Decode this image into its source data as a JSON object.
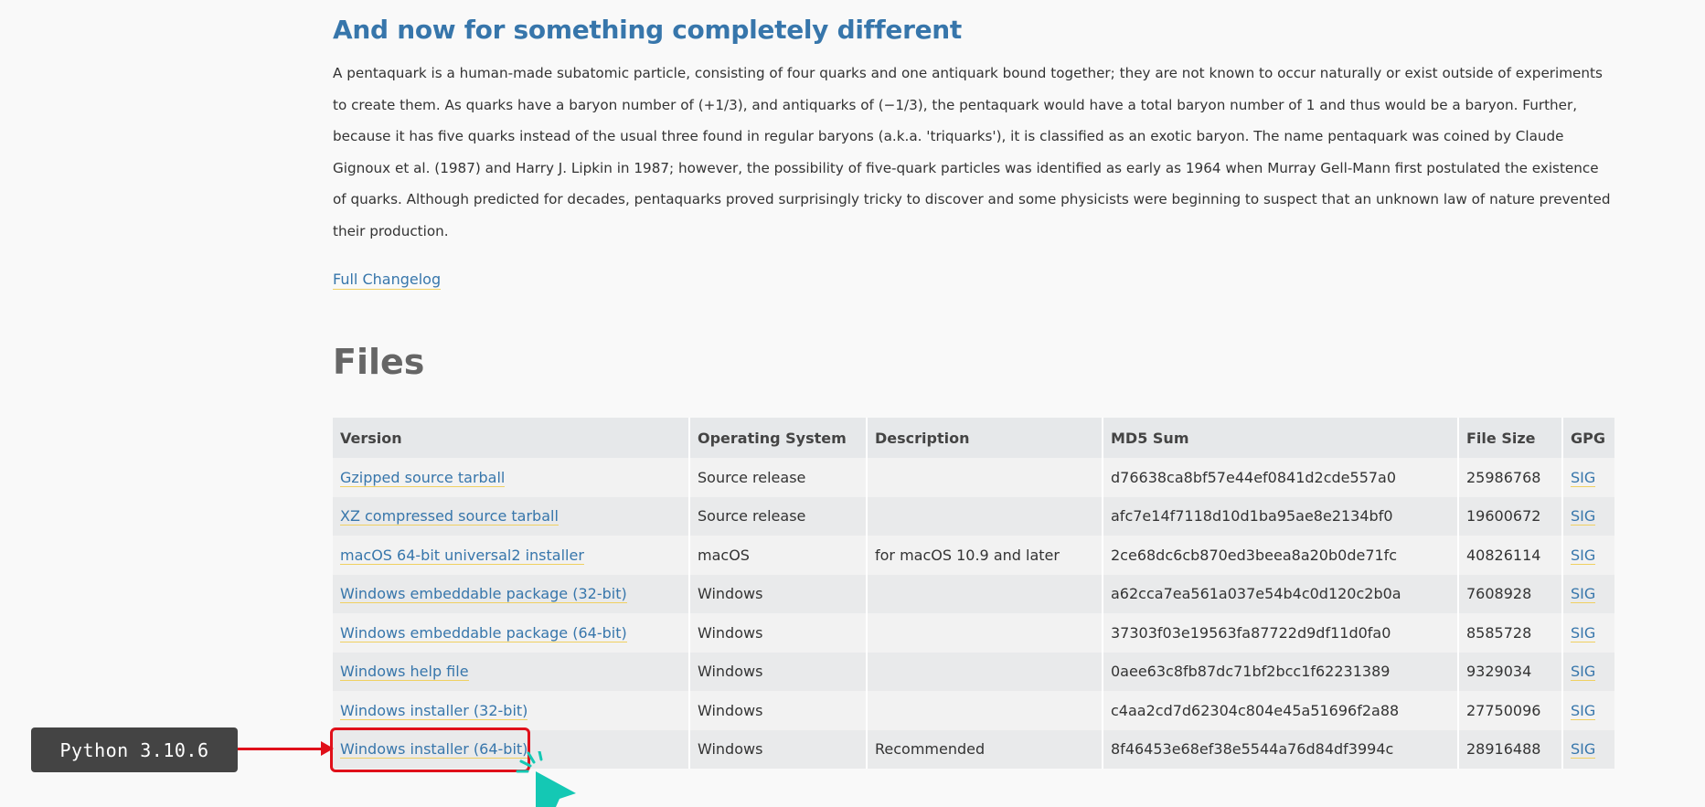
{
  "article": {
    "heading": "And now for something completely different",
    "paragraph": "A pentaquark is a human-made subatomic particle, consisting of four quarks and one antiquark bound together; they are not known to occur naturally or exist outside of experiments to create them. As quarks have a baryon number of (+1/3), and antiquarks of (−1/3), the pentaquark would have a total baryon number of 1 and thus would be a baryon. Further, because it has five quarks instead of the usual three found in regular baryons (a.k.a. 'triquarks'), it is classified as an exotic baryon. The name pentaquark was coined by Claude Gignoux et al. (1987) and Harry J. Lipkin in 1987; however, the possibility of five-quark particles was identified as early as 1964 when Murray Gell-Mann first postulated the existence of quarks. Although predicted for decades, pentaquarks proved surprisingly tricky to discover and some physicists were beginning to suspect that an unknown law of nature prevented their production.",
    "changelog_link": "Full Changelog"
  },
  "files": {
    "heading": "Files",
    "columns": [
      "Version",
      "Operating System",
      "Description",
      "MD5 Sum",
      "File Size",
      "GPG"
    ],
    "rows": [
      {
        "version": "Gzipped source tarball",
        "os": "Source release",
        "description": "",
        "md5": "d76638ca8bf57e44ef0841d2cde557a0",
        "size": "25986768",
        "gpg": "SIG"
      },
      {
        "version": "XZ compressed source tarball",
        "os": "Source release",
        "description": "",
        "md5": "afc7e14f7118d10d1ba95ae8e2134bf0",
        "size": "19600672",
        "gpg": "SIG"
      },
      {
        "version": "macOS 64-bit universal2 installer",
        "os": "macOS",
        "description": "for macOS 10.9 and later",
        "md5": "2ce68dc6cb870ed3beea8a20b0de71fc",
        "size": "40826114",
        "gpg": "SIG"
      },
      {
        "version": "Windows embeddable package (32-bit)",
        "os": "Windows",
        "description": "",
        "md5": "a62cca7ea561a037e54b4c0d120c2b0a",
        "size": "7608928",
        "gpg": "SIG"
      },
      {
        "version": "Windows embeddable package (64-bit)",
        "os": "Windows",
        "description": "",
        "md5": "37303f03e19563fa87722d9df11d0fa0",
        "size": "8585728",
        "gpg": "SIG"
      },
      {
        "version": "Windows help file",
        "os": "Windows",
        "description": "",
        "md5": "0aee63c8fb87dc71bf2bcc1f62231389",
        "size": "9329034",
        "gpg": "SIG"
      },
      {
        "version": "Windows installer (32-bit)",
        "os": "Windows",
        "description": "",
        "md5": "c4aa2cd7d62304c804e45a51696f2a88",
        "size": "27750096",
        "gpg": "SIG"
      },
      {
        "version": "Windows installer (64-bit)",
        "os": "Windows",
        "description": "Recommended",
        "md5": "8f46453e68ef38e5544a76d84df3994c",
        "size": "28916488",
        "gpg": "SIG"
      }
    ]
  },
  "annotation": {
    "label": "Python 3.10.6",
    "color": "#e0101a",
    "cursor_color": "#14c8b4"
  }
}
